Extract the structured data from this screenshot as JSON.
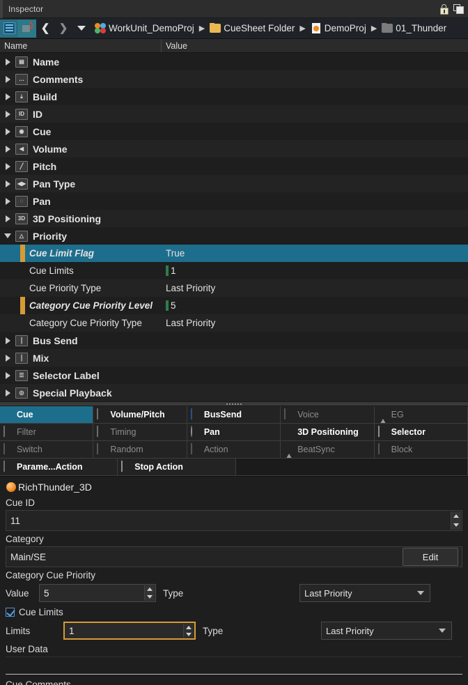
{
  "window": {
    "title": "Inspector",
    "icons": {
      "lock": "lock-icon",
      "float": "float-window-icon"
    }
  },
  "toolbar": {
    "buttons": [
      "list-view-button",
      "undo-button",
      "back-button",
      "forward-button",
      "dropdown-button"
    ],
    "breadcrumb": [
      {
        "label": "WorkUnit_DemoProj",
        "icon": "workunit-icon"
      },
      {
        "label": "CueSheet Folder",
        "icon": "folder-yellow-icon"
      },
      {
        "label": "DemoProj",
        "icon": "cuesheet-doc-icon"
      },
      {
        "label": "01_Thunder",
        "icon": "folder-grey-icon"
      }
    ],
    "separator": "▶"
  },
  "tree": {
    "columns": {
      "name": "Name",
      "value": "Value"
    },
    "rows": [
      {
        "label": "Name",
        "value": "",
        "icon": "name-icon",
        "glyph": "▤",
        "expanded": false,
        "level": 0
      },
      {
        "label": "Comments",
        "value": "",
        "icon": "comments-icon",
        "glyph": "…",
        "expanded": false,
        "level": 0
      },
      {
        "label": "Build",
        "value": "",
        "icon": "build-icon",
        "glyph": "⤓",
        "expanded": false,
        "level": 0
      },
      {
        "label": "ID",
        "value": "",
        "icon": "id-icon",
        "glyph": "ID",
        "expanded": false,
        "level": 0
      },
      {
        "label": "Cue",
        "value": "",
        "icon": "cue-icon",
        "glyph": "◉",
        "expanded": false,
        "level": 0
      },
      {
        "label": "Volume",
        "value": "",
        "icon": "volume-icon",
        "glyph": "◀",
        "expanded": false,
        "level": 0
      },
      {
        "label": "Pitch",
        "value": "",
        "icon": "pitch-icon",
        "glyph": "╱",
        "expanded": false,
        "level": 0
      },
      {
        "label": "Pan Type",
        "value": "",
        "icon": "pan-type-icon",
        "glyph": "◀▶",
        "expanded": false,
        "level": 0
      },
      {
        "label": "Pan",
        "value": "",
        "icon": "pan-icon",
        "glyph": "◌",
        "expanded": false,
        "level": 0
      },
      {
        "label": "3D Positioning",
        "value": "",
        "icon": "3d-positioning-icon",
        "glyph": "3D",
        "expanded": false,
        "level": 0
      },
      {
        "label": "Priority",
        "value": "",
        "icon": "priority-icon",
        "glyph": "△",
        "expanded": true,
        "level": 0
      }
    ],
    "children": [
      {
        "label": "Cue Limit Flag",
        "value": "True",
        "selected": true,
        "modified": true,
        "greenmark": false
      },
      {
        "label": "Cue Limits",
        "value": "1",
        "selected": false,
        "modified": false,
        "greenmark": true
      },
      {
        "label": "Cue Priority Type",
        "value": "Last Priority",
        "selected": false,
        "modified": false,
        "greenmark": false
      },
      {
        "label": "Category Cue Priority Level",
        "value": "5",
        "selected": false,
        "modified": true,
        "greenmark": true
      },
      {
        "label": "Category Cue Priority Type",
        "value": "Last Priority",
        "selected": false,
        "modified": false,
        "greenmark": false
      }
    ],
    "rows_after": [
      {
        "label": "Bus Send",
        "value": "",
        "icon": "bus-send-icon",
        "glyph": "║",
        "expanded": false,
        "level": 0
      },
      {
        "label": "Mix",
        "value": "",
        "icon": "mix-icon",
        "glyph": "║",
        "expanded": false,
        "level": 0
      },
      {
        "label": "Selector Label",
        "value": "",
        "icon": "selector-label-icon",
        "glyph": "☰",
        "expanded": false,
        "level": 0
      },
      {
        "label": "Special Playback",
        "value": "",
        "icon": "special-playback-icon",
        "glyph": "◎",
        "expanded": false,
        "level": 0
      }
    ]
  },
  "tabs": {
    "rows": [
      [
        {
          "label": "Cue",
          "state": "active",
          "icon": "cue-sphere-icon",
          "style": "sphere"
        },
        {
          "label": "Volume/Pitch",
          "state": "on",
          "icon": "volume-pitch-icon",
          "style": "dk"
        },
        {
          "label": "BusSend",
          "state": "on",
          "icon": "bussend-icon",
          "style": "blue"
        },
        {
          "label": "Voice",
          "state": "off",
          "icon": "voice-icon",
          "style": "grey"
        },
        {
          "label": "EG",
          "state": "off",
          "icon": "eg-icon",
          "style": "tri"
        }
      ],
      [
        {
          "label": "Filter",
          "state": "off",
          "icon": "filter-icon",
          "style": "dk"
        },
        {
          "label": "Timing",
          "state": "off",
          "icon": "timing-icon",
          "style": "dk"
        },
        {
          "label": "Pan",
          "state": "on",
          "icon": "pan-tab-icon",
          "style": "teal"
        },
        {
          "label": "3D Positioning",
          "state": "on",
          "icon": "3d-positioning-tab-icon",
          "style": "axis"
        },
        {
          "label": "Selector",
          "state": "on",
          "icon": "selector-tab-icon",
          "style": "sel"
        }
      ],
      [
        {
          "label": "Switch",
          "state": "off",
          "icon": "switch-icon",
          "style": "grey"
        },
        {
          "label": "Random",
          "state": "off",
          "icon": "random-icon",
          "style": "grey"
        },
        {
          "label": "Action",
          "state": "off",
          "icon": "action-icon",
          "style": "grey"
        },
        {
          "label": "BeatSync",
          "state": "off",
          "icon": "beatsync-icon",
          "style": "tri"
        },
        {
          "label": "Block",
          "state": "off",
          "icon": "block-icon",
          "style": "grey"
        }
      ],
      [
        {
          "label": "Parame...Action",
          "state": "on",
          "icon": "parameter-action-icon",
          "style": "dk"
        },
        {
          "label": "Stop Action",
          "state": "on",
          "icon": "stop-action-icon",
          "style": "green"
        },
        {
          "label": "",
          "state": "blank",
          "icon": "",
          "style": ""
        }
      ]
    ]
  },
  "form": {
    "cue_name": "RichThunder_3D",
    "cue_id_label": "Cue ID",
    "cue_id_value": "11",
    "category_label": "Category",
    "category_value": "Main/SE",
    "edit_button": "Edit",
    "category_cue_priority_label": "Category Cue Priority",
    "value_label": "Value",
    "value_value": "5",
    "type_label": "Type",
    "type_value": "Last Priority",
    "cue_limits_checkbox": "Cue Limits",
    "limits_label": "Limits",
    "limits_value": "1",
    "limits_type_label": "Type",
    "limits_type_value": "Last Priority",
    "user_data_label": "User Data",
    "user_data_value": "",
    "cue_comments_label": "Cue Comments"
  },
  "colors": {
    "accent_selected": "#1d6e8c",
    "marker_modified": "#d79b36",
    "marker_green": "#2f7d46",
    "background": "#1e1e1e",
    "focus_border": "#d79b36"
  }
}
